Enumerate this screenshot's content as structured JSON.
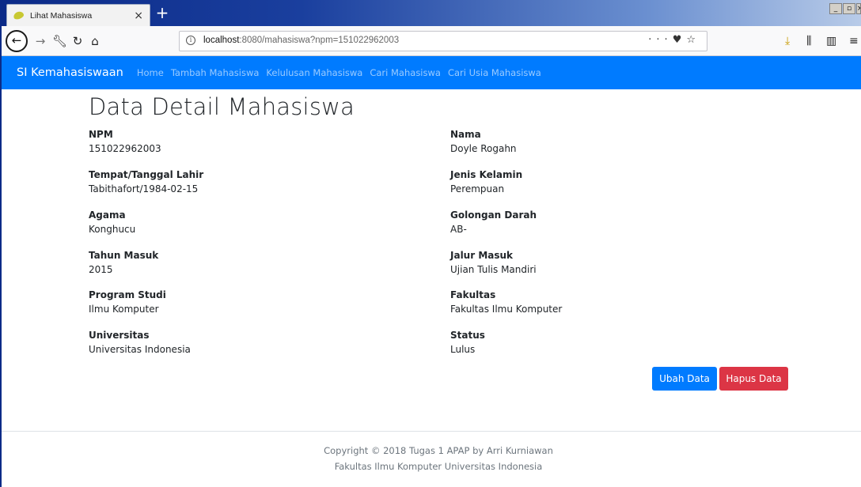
{
  "browser": {
    "tab_title": "Lihat Mahasiswa",
    "tab_close": "×",
    "new_tab": "+",
    "url_host": "localhost",
    "url_rest": ":8080/mahasiswa?npm=151022962003",
    "url_more": "···",
    "icons": [
      "back-icon",
      "forward-icon",
      "wrench-icon",
      "reload-icon",
      "home-icon",
      "info-icon",
      "pocket-icon",
      "bookmark-star-icon",
      "download-icon",
      "library-icon",
      "sidebar-icon",
      "menu-icon"
    ]
  },
  "app": {
    "brand": "SI Kemahasiswaan",
    "nav": [
      "Home",
      "Tambah Mahasiswa",
      "Kelulusan Mahasiswa",
      "Cari Mahasiswa",
      "Cari Usia Mahasiswa"
    ],
    "brand_color": "#007bff"
  },
  "page": {
    "title": "Data Detail Mahasiswa",
    "left": [
      {
        "label": "NPM",
        "value": "151022962003"
      },
      {
        "label": "Tempat/Tanggal Lahir",
        "value": "Tabithafort/1984-02-15"
      },
      {
        "label": "Agama",
        "value": "Konghucu"
      },
      {
        "label": "Tahun Masuk",
        "value": "2015"
      },
      {
        "label": "Program Studi",
        "value": "Ilmu Komputer"
      },
      {
        "label": "Universitas",
        "value": "Universitas Indonesia"
      }
    ],
    "right": [
      {
        "label": "Nama",
        "value": "Doyle Rogahn"
      },
      {
        "label": "Jenis Kelamin",
        "value": "Perempuan"
      },
      {
        "label": "Golongan Darah",
        "value": "AB-"
      },
      {
        "label": "Jalur Masuk",
        "value": "Ujian Tulis Mandiri"
      },
      {
        "label": "Fakultas",
        "value": "Fakultas Ilmu Komputer"
      },
      {
        "label": "Status",
        "value": "Lulus"
      }
    ],
    "edit_button": "Ubah Data",
    "delete_button": "Hapus Data",
    "primary_color": "#007bff",
    "danger_color": "#dc3545"
  },
  "footer": {
    "line1": "Copyright © 2018 Tugas 1 APAP by Arri Kurniawan",
    "line2": "Fakultas Ilmu Komputer Universitas Indonesia"
  }
}
